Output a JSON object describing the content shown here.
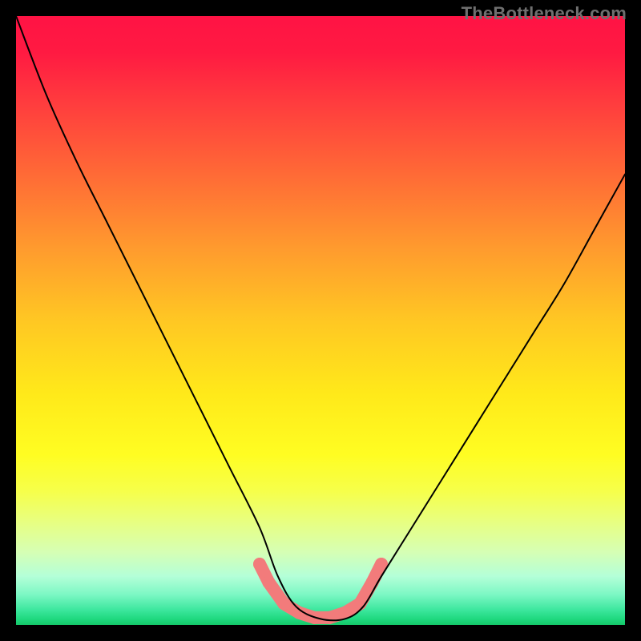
{
  "watermark": "TheBottleneck.com",
  "chart_data": {
    "type": "line",
    "title": "",
    "xlabel": "",
    "ylabel": "",
    "xlim": [
      0,
      100
    ],
    "ylim": [
      0,
      100
    ],
    "grid": false,
    "legend": false,
    "series": [
      {
        "name": "bottleneck-curve",
        "x": [
          0,
          5,
          10,
          15,
          20,
          25,
          30,
          35,
          40,
          43,
          46,
          50,
          54,
          57,
          60,
          65,
          70,
          75,
          80,
          85,
          90,
          95,
          100
        ],
        "values": [
          100,
          87,
          76,
          66,
          56,
          46,
          36,
          26,
          16,
          8,
          3,
          1,
          1,
          3,
          8,
          16,
          24,
          32,
          40,
          48,
          56,
          65,
          74
        ],
        "color": "#000000",
        "width": 2
      }
    ],
    "markers": [
      {
        "name": "trough-points",
        "x": [
          40,
          41.5,
          44,
          46.5,
          49,
          51.5,
          54,
          56.5,
          58.5,
          60
        ],
        "y": [
          10,
          7,
          3.5,
          2,
          1.2,
          1.2,
          2,
          3.5,
          7,
          10
        ],
        "color": "#f27b7b",
        "size": 16
      }
    ],
    "gradient_stops": [
      {
        "pos": 0,
        "color": "#ff1344"
      },
      {
        "pos": 26,
        "color": "#ff6a36"
      },
      {
        "pos": 50,
        "color": "#ffc723"
      },
      {
        "pos": 72,
        "color": "#fffd22"
      },
      {
        "pos": 88,
        "color": "#d6ffb4"
      },
      {
        "pos": 97,
        "color": "#3de79e"
      },
      {
        "pos": 100,
        "color": "#14c768"
      }
    ]
  }
}
